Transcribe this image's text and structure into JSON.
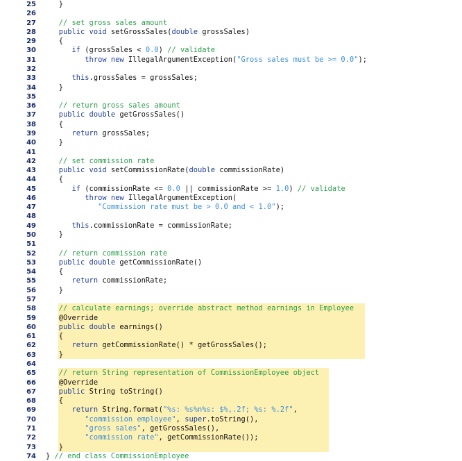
{
  "lines": [
    {
      "n": "25",
      "t": [
        [
          "p",
          "   }"
        ]
      ]
    },
    {
      "n": "26",
      "t": []
    },
    {
      "n": "27",
      "t": [
        [
          "c",
          "   // set gross sales amount"
        ]
      ]
    },
    {
      "n": "28",
      "t": [
        [
          "k",
          "   public void "
        ],
        [
          "p",
          "setGrossSales("
        ],
        [
          "k",
          "double"
        ],
        [
          "p",
          " grossSales)"
        ]
      ]
    },
    {
      "n": "29",
      "t": [
        [
          "p",
          "   {"
        ]
      ]
    },
    {
      "n": "30",
      "t": [
        [
          "k",
          "      if"
        ],
        [
          "p",
          " (grossSales < "
        ],
        [
          "s",
          "0.0"
        ],
        [
          "p",
          ") "
        ],
        [
          "c",
          "// validate"
        ]
      ]
    },
    {
      "n": "31",
      "t": [
        [
          "k",
          "         throw new"
        ],
        [
          "p",
          " IllegalArgumentException("
        ],
        [
          "s",
          "\"Gross sales must be >= 0.0\""
        ],
        [
          "p",
          ");"
        ]
      ]
    },
    {
      "n": "32",
      "t": []
    },
    {
      "n": "33",
      "t": [
        [
          "k",
          "      this"
        ],
        [
          "p",
          ".grossSales = grossSales;"
        ]
      ]
    },
    {
      "n": "34",
      "t": [
        [
          "p",
          "   }"
        ]
      ]
    },
    {
      "n": "35",
      "t": []
    },
    {
      "n": "36",
      "t": [
        [
          "c",
          "   // return gross sales amount"
        ]
      ]
    },
    {
      "n": "37",
      "t": [
        [
          "k",
          "   public double "
        ],
        [
          "p",
          "getGrossSales()"
        ]
      ]
    },
    {
      "n": "38",
      "t": [
        [
          "p",
          "   {"
        ]
      ]
    },
    {
      "n": "39",
      "t": [
        [
          "k",
          "      return"
        ],
        [
          "p",
          " grossSales;"
        ]
      ]
    },
    {
      "n": "40",
      "t": [
        [
          "p",
          "   }"
        ]
      ]
    },
    {
      "n": "41",
      "t": []
    },
    {
      "n": "42",
      "t": [
        [
          "c",
          "   // set commission rate"
        ]
      ]
    },
    {
      "n": "43",
      "t": [
        [
          "k",
          "   public void "
        ],
        [
          "p",
          "setCommissionRate("
        ],
        [
          "k",
          "double"
        ],
        [
          "p",
          " commissionRate)"
        ]
      ]
    },
    {
      "n": "44",
      "t": [
        [
          "p",
          "   {"
        ]
      ]
    },
    {
      "n": "45",
      "t": [
        [
          "k",
          "      if"
        ],
        [
          "p",
          " (commissionRate <= "
        ],
        [
          "s",
          "0.0"
        ],
        [
          "p",
          " || commissionRate >= "
        ],
        [
          "s",
          "1.0"
        ],
        [
          "p",
          ") "
        ],
        [
          "c",
          "// validate"
        ]
      ]
    },
    {
      "n": "46",
      "t": [
        [
          "k",
          "         throw new"
        ],
        [
          "p",
          " IllegalArgumentException("
        ]
      ]
    },
    {
      "n": "47",
      "t": [
        [
          "s",
          "            \"Commission rate must be > 0.0 and < 1.0\""
        ],
        [
          "p",
          ");"
        ]
      ]
    },
    {
      "n": "48",
      "t": []
    },
    {
      "n": "49",
      "t": [
        [
          "k",
          "      this"
        ],
        [
          "p",
          ".commissionRate = commissionRate;"
        ]
      ]
    },
    {
      "n": "50",
      "t": [
        [
          "p",
          "   }"
        ]
      ]
    },
    {
      "n": "51",
      "t": []
    },
    {
      "n": "52",
      "t": [
        [
          "c",
          "   // return commission rate"
        ]
      ]
    },
    {
      "n": "53",
      "t": [
        [
          "k",
          "   public double "
        ],
        [
          "p",
          "getCommissionRate()"
        ]
      ]
    },
    {
      "n": "54",
      "t": [
        [
          "p",
          "   {"
        ]
      ]
    },
    {
      "n": "55",
      "t": [
        [
          "k",
          "      return"
        ],
        [
          "p",
          " commissionRate;"
        ]
      ]
    },
    {
      "n": "56",
      "t": [
        [
          "p",
          "   }"
        ]
      ]
    },
    {
      "n": "57",
      "t": []
    },
    {
      "n": "58",
      "t": [
        [
          "c",
          "   // calculate earnings; override abstract method earnings in Employee"
        ]
      ]
    },
    {
      "n": "59",
      "t": [
        [
          "p",
          "   @Override"
        ]
      ]
    },
    {
      "n": "60",
      "t": [
        [
          "k",
          "   public double "
        ],
        [
          "p",
          "earnings()"
        ]
      ]
    },
    {
      "n": "61",
      "t": [
        [
          "p",
          "   {"
        ]
      ]
    },
    {
      "n": "62",
      "t": [
        [
          "k",
          "      return"
        ],
        [
          "p",
          " getCommissionRate() * getGrossSales();"
        ]
      ]
    },
    {
      "n": "63",
      "t": [
        [
          "p",
          "   }"
        ]
      ]
    },
    {
      "n": "64",
      "t": []
    },
    {
      "n": "65",
      "t": [
        [
          "c",
          "   // return String representation of CommissionEmployee object"
        ]
      ]
    },
    {
      "n": "66",
      "t": [
        [
          "p",
          "   @Override"
        ]
      ]
    },
    {
      "n": "67",
      "t": [
        [
          "k",
          "   public"
        ],
        [
          "p",
          " String toString()"
        ]
      ]
    },
    {
      "n": "68",
      "t": [
        [
          "p",
          "   {"
        ]
      ]
    },
    {
      "n": "69",
      "t": [
        [
          "k",
          "      return"
        ],
        [
          "p",
          " String.format("
        ],
        [
          "s",
          "\"%s: %s%n%s: $%,.2f; %s: %.2f\""
        ],
        [
          "p",
          ","
        ]
      ]
    },
    {
      "n": "70",
      "t": [
        [
          "s",
          "         \"commission employee\""
        ],
        [
          "p",
          ", "
        ],
        [
          "k",
          "super"
        ],
        [
          "p",
          ".toString(),"
        ]
      ]
    },
    {
      "n": "71",
      "t": [
        [
          "s",
          "         \"gross sales\""
        ],
        [
          "p",
          ", getGrossSales(),"
        ]
      ]
    },
    {
      "n": "72",
      "t": [
        [
          "s",
          "         \"commission rate\""
        ],
        [
          "p",
          ", getCommissionRate());"
        ]
      ]
    },
    {
      "n": "73",
      "t": [
        [
          "p",
          "   }"
        ]
      ]
    },
    {
      "n": "74",
      "t": [
        [
          "p",
          "} "
        ],
        [
          "c",
          "// end class CommissionEmployee"
        ]
      ]
    }
  ],
  "colors": {
    "keyword": "#1f3f94",
    "comment": "#2a9e4a",
    "string": "#3a8fd9",
    "highlight": "#fdf0b3"
  }
}
